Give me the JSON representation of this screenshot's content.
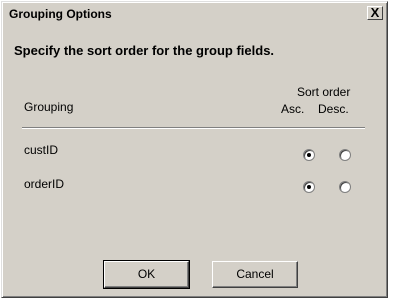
{
  "dialog": {
    "title": "Grouping Options",
    "close_label": "X",
    "instruction": "Specify the sort order for the group fields."
  },
  "columns": {
    "grouping": "Grouping",
    "sort_order": "Sort order",
    "asc": "Asc.",
    "desc": "Desc."
  },
  "rows": [
    {
      "field": "custID",
      "sort": "Asc."
    },
    {
      "field": "orderID",
      "sort": "Asc."
    }
  ],
  "buttons": {
    "ok": "OK",
    "cancel": "Cancel"
  }
}
